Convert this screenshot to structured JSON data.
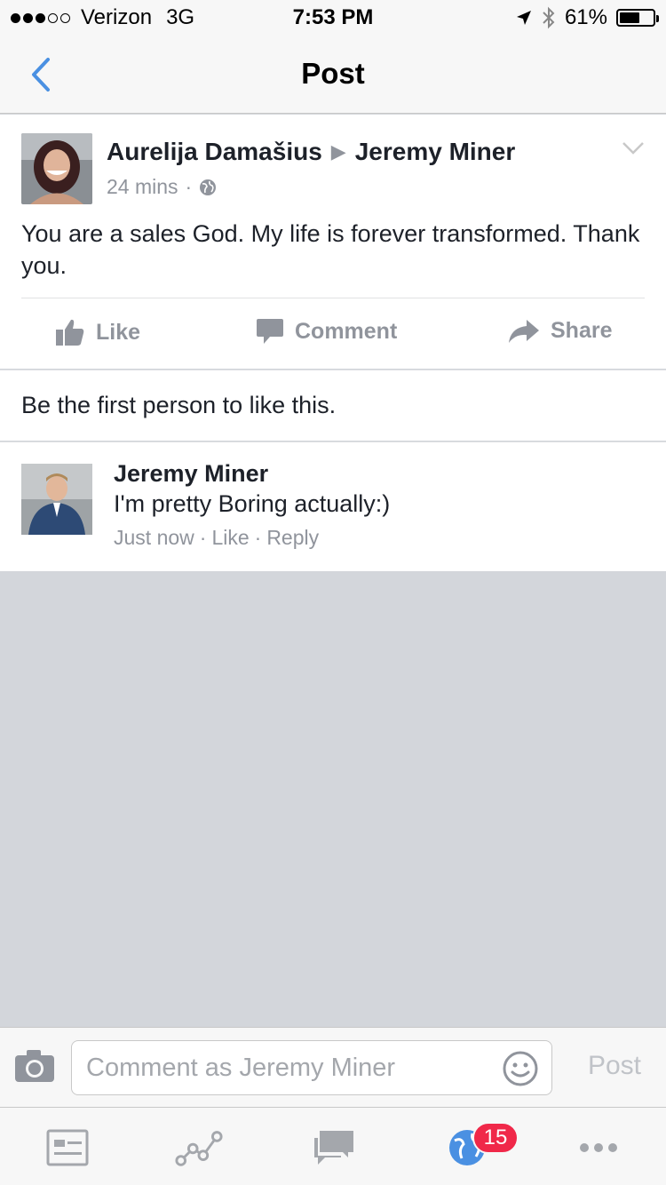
{
  "status_bar": {
    "carrier": "Verizon",
    "network": "3G",
    "time": "7:53 PM",
    "battery": "61%",
    "battery_level": 0.61
  },
  "nav": {
    "title": "Post"
  },
  "post": {
    "author": "Aurelija Damašius",
    "target": "Jeremy Miner",
    "time": "24 mins",
    "text": "You are a sales God. My life is forever transformed. Thank you.",
    "actions": {
      "like": "Like",
      "comment": "Comment",
      "share": "Share"
    }
  },
  "likes_text": "Be the first person to like this.",
  "comment": {
    "author": "Jeremy Miner",
    "text": "I'm pretty Boring actually:)",
    "time": "Just now",
    "like": "Like",
    "reply": "Reply",
    "separator": "·"
  },
  "composer": {
    "placeholder": "Comment as Jeremy Miner",
    "post_label": "Post"
  },
  "tabbar": {
    "badge": "15"
  },
  "colors": {
    "accent": "#4a90e2",
    "badge": "#f02849",
    "muted": "#90949c"
  }
}
